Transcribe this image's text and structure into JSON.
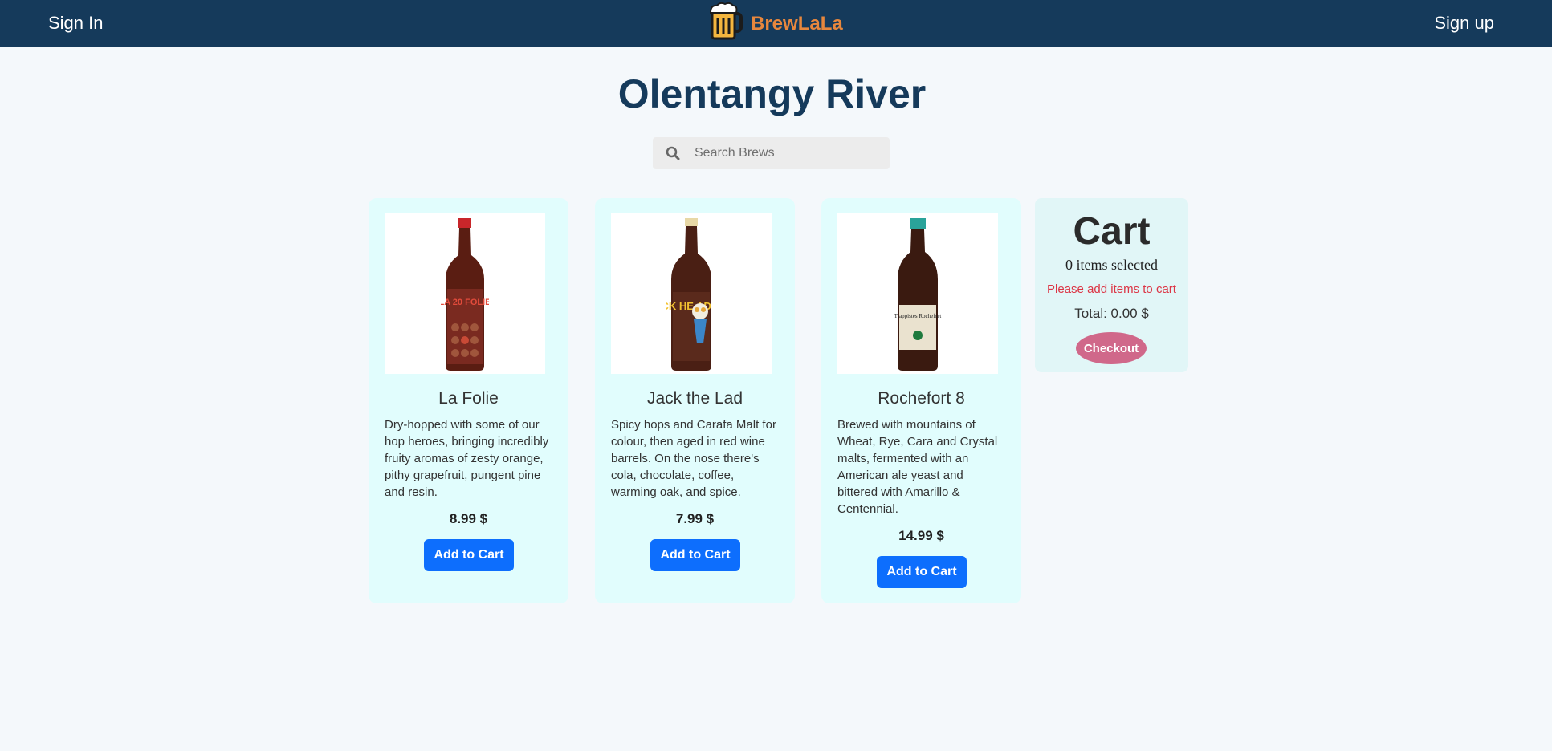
{
  "nav": {
    "sign_in": "Sign In",
    "sign_up": "Sign up",
    "brand_name": "BrewLaLa",
    "brand_icon": "beer-mug-icon",
    "colors": {
      "bar": "#153a5b",
      "brand": "#e7873d"
    }
  },
  "page": {
    "title": "Olentangy River"
  },
  "search": {
    "placeholder": "Search Brews",
    "value": "",
    "icon": "search-icon"
  },
  "products": [
    {
      "name": "La Folie",
      "description": "Dry-hopped with some of our hop heroes, bringing incredibly fruity aromas of zesty orange, pithy grapefruit, pungent pine and resin.",
      "price": "8.99 $",
      "button": "Add to Cart",
      "image": "beer-bottle-red-label",
      "bottle_label": "LA 20 FOLIE"
    },
    {
      "name": "Jack the Lad",
      "description": "Spicy hops and Carafa Malt for colour, then aged in red wine barrels. On the nose there's cola, chocolate, coffee, warming oak, and spice.",
      "price": "7.99 $",
      "button": "Add to Cart",
      "image": "beer-bottle-jack-label",
      "bottle_label": "ACK HE AD"
    },
    {
      "name": "Rochefort 8",
      "description": "Brewed with mountains of Wheat, Rye, Cara and Crystal malts, fermented with an American ale yeast and bittered with Amarillo & Centennial.",
      "price": "14.99 $",
      "button": "Add to Cart",
      "image": "beer-bottle-trappist-label",
      "bottle_label": "Trappistes Rochefort"
    }
  ],
  "cart": {
    "title": "Cart",
    "count_text": "0 items selected",
    "warning": "Please add items to cart",
    "total": "Total: 0.00 $",
    "checkout": "Checkout",
    "colors": {
      "warning": "#dc3545",
      "checkout": "#d0688a"
    }
  }
}
